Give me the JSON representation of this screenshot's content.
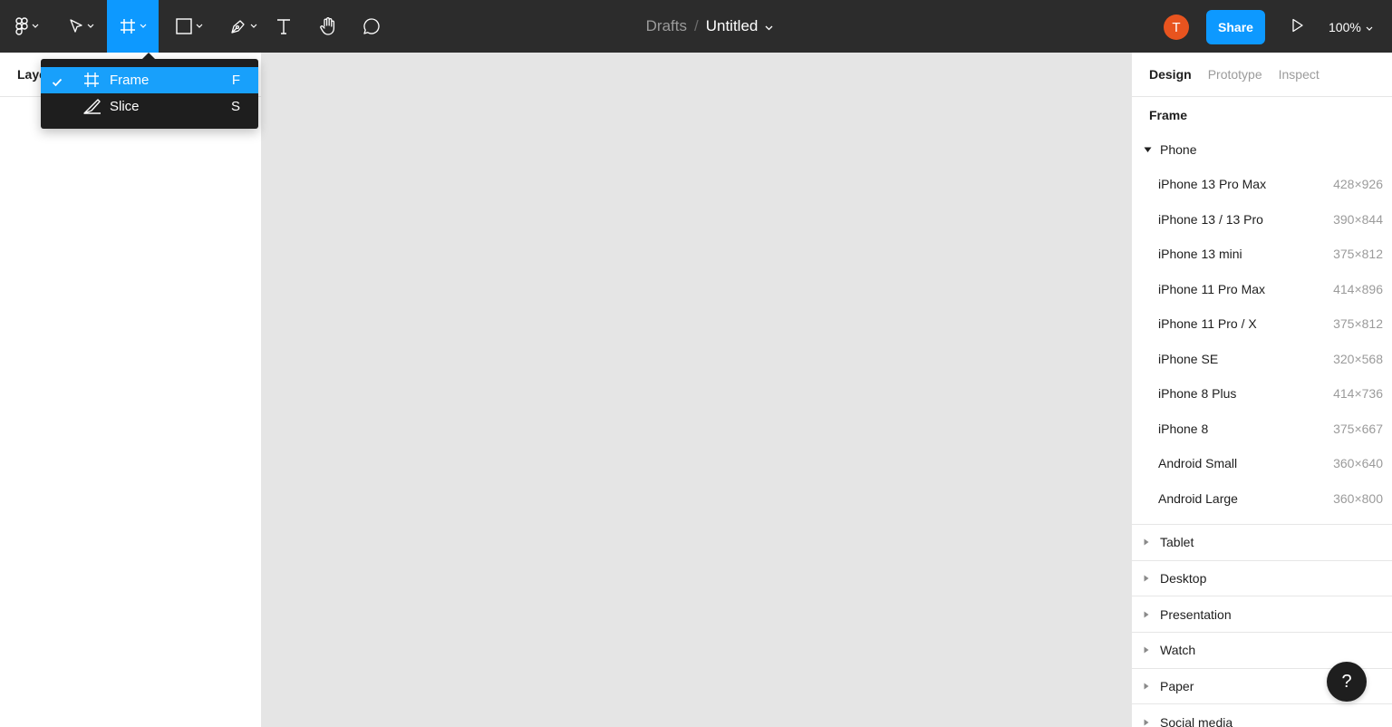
{
  "toolbar": {
    "breadcrumb_parent": "Drafts",
    "breadcrumb_separator": "/",
    "file_name": "Untitled",
    "avatar_initial": "T",
    "share_label": "Share",
    "zoom_level": "100%",
    "active_tool": "frame",
    "accent_color": "#0d99ff"
  },
  "left_panel": {
    "header": "Layers"
  },
  "frame_menu": {
    "items": [
      {
        "label": "Frame",
        "shortcut": "F",
        "icon": "frame-icon",
        "selected": true
      },
      {
        "label": "Slice",
        "shortcut": "S",
        "icon": "slice-icon",
        "selected": false
      }
    ]
  },
  "right_panel": {
    "tabs": [
      {
        "label": "Design",
        "active": true
      },
      {
        "label": "Prototype",
        "active": false
      },
      {
        "label": "Inspect",
        "active": false
      }
    ],
    "section_title": "Frame",
    "expanded_group": {
      "label": "Phone",
      "presets": [
        {
          "name": "iPhone 13 Pro Max",
          "size": "428×926"
        },
        {
          "name": "iPhone 13 / 13 Pro",
          "size": "390×844"
        },
        {
          "name": "iPhone 13 mini",
          "size": "375×812"
        },
        {
          "name": "iPhone 11 Pro Max",
          "size": "414×896"
        },
        {
          "name": "iPhone 11 Pro / X",
          "size": "375×812"
        },
        {
          "name": "iPhone SE",
          "size": "320×568"
        },
        {
          "name": "iPhone 8 Plus",
          "size": "414×736"
        },
        {
          "name": "iPhone 8",
          "size": "375×667"
        },
        {
          "name": "Android Small",
          "size": "360×640"
        },
        {
          "name": "Android Large",
          "size": "360×800"
        }
      ]
    },
    "collapsed_groups": [
      "Tablet",
      "Desktop",
      "Presentation",
      "Watch",
      "Paper",
      "Social media"
    ]
  },
  "help": {
    "label": "?"
  }
}
